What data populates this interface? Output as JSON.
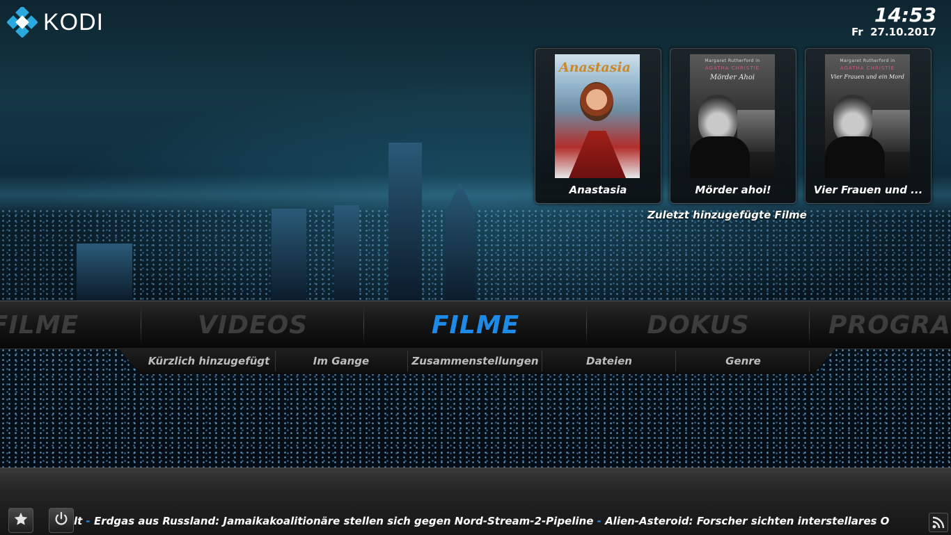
{
  "app": {
    "name": "KODI"
  },
  "clock": {
    "time": "14:53",
    "date": "Fr  27.10.2017"
  },
  "recently_added": {
    "caption": "Zuletzt hinzugefügte Filme",
    "items": [
      {
        "title": "Anastasia",
        "poster_title": "Anastasia"
      },
      {
        "title": "Mörder ahoi!",
        "poster_header": "Margaret Rutherford in",
        "poster_brand": "AGATHA CHRISTIE",
        "poster_subtitle": "Mörder Ahoi"
      },
      {
        "title": "Vier Frauen und ...",
        "poster_header": "Margaret Rutherford in",
        "poster_brand": "AGATHA CHRISTIE",
        "poster_subtitle": "Vier Frauen und ein Mord"
      }
    ]
  },
  "main_menu": {
    "items": [
      "-FILME",
      "VIDEOS",
      "FILME",
      "DOKUS",
      "PROGRA"
    ],
    "active": "FILME"
  },
  "submenu": {
    "items": [
      "Kürzlich hinzugefügt",
      "Im Gange",
      "Zusammenstellungen",
      "Dateien",
      "Genre"
    ]
  },
  "ticker": {
    "segments": [
      "lt",
      "Erdgas aus Russland: Jamaikakoalitionäre stellen sich gegen Nord-Stream-2-Pipeline",
      "Alien-Asteroid: Forscher sichten interstellares O"
    ],
    "separator": "-"
  },
  "icons": {
    "favourites": "star-icon",
    "power": "power-icon",
    "rss": "rss-icon"
  },
  "colors": {
    "accent": "#1e8ae8",
    "inactive_menu": "#3d3d3d",
    "ticker_separator": "#2a8fe6"
  }
}
